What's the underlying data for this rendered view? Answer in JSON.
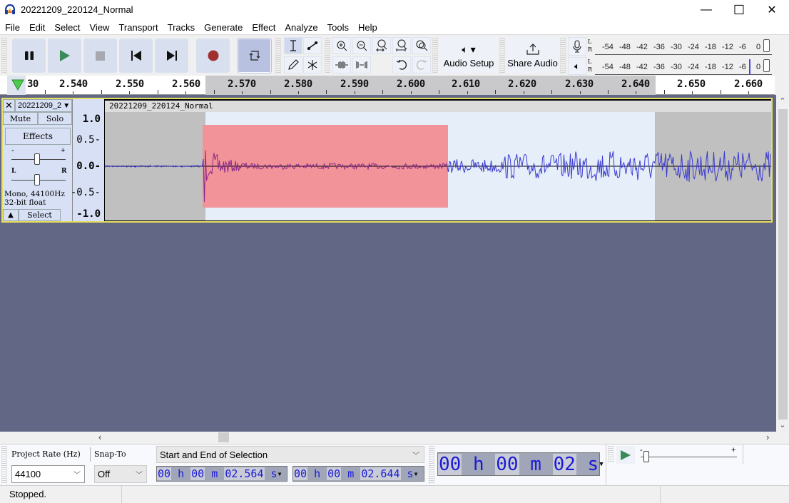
{
  "window": {
    "title": "20221209_220124_Normal",
    "minimize_glyph": "—",
    "maximize_glyph": "☐",
    "close_glyph": "✕"
  },
  "menu": [
    "File",
    "Edit",
    "Select",
    "View",
    "Transport",
    "Tracks",
    "Generate",
    "Effect",
    "Analyze",
    "Tools",
    "Help"
  ],
  "toolbar": {
    "audio_setup_label": "Audio Setup",
    "share_audio_label": "Share Audio",
    "meter_scale": [
      "-54",
      "-48",
      "-42",
      "-36",
      "-30",
      "-24",
      "-18",
      "-12",
      "-6",
      "0"
    ],
    "record_meter_channels": [
      "L",
      "R"
    ],
    "play_meter_channels": [
      "L",
      "R"
    ],
    "accent_play": "#3a8a5a",
    "accent_record": "#a03030"
  },
  "ruler": {
    "labels": [
      "30",
      "2.540",
      "2.550",
      "2.560",
      "2.570",
      "2.580",
      "2.590",
      "2.600",
      "2.610",
      "2.620",
      "2.630",
      "2.640",
      "2.650",
      "2.660"
    ],
    "selection_start": 2.5625,
    "selection_end": 2.6425
  },
  "track": {
    "name": "20221209_2",
    "clip_name": "20221209_220124_Normal",
    "mute_label": "Mute",
    "solo_label": "Solo",
    "effects_label": "Effects",
    "gain_minus": "-",
    "gain_plus": "+",
    "pan_left": "L",
    "pan_right": "R",
    "info_line1": "Mono, 44100Hz",
    "info_line2": "32-bit float",
    "select_label": "Select",
    "vscale": [
      "1.0",
      "0.5-",
      "0.0-",
      "-0.5-",
      "-1.0"
    ],
    "wave_color": "#3a3ad0",
    "selection_color": "#f29399"
  },
  "bottom": {
    "project_rate_label": "Project Rate (Hz)",
    "snap_to_label": "Snap-To",
    "project_rate_value": "44100",
    "snap_value": "Off",
    "selection_mode": "Start and End of Selection",
    "start_time": {
      "h": "00",
      "m": "00",
      "s": "02.564"
    },
    "end_time": {
      "h": "00",
      "m": "00",
      "s": "02.644"
    },
    "audio_position": {
      "h": "00",
      "m": "00",
      "s": "02"
    },
    "unit_h": "h",
    "unit_m": "m",
    "unit_s": "s",
    "speed_minus": "-",
    "speed_plus": "+"
  },
  "status": {
    "text": "Stopped."
  }
}
